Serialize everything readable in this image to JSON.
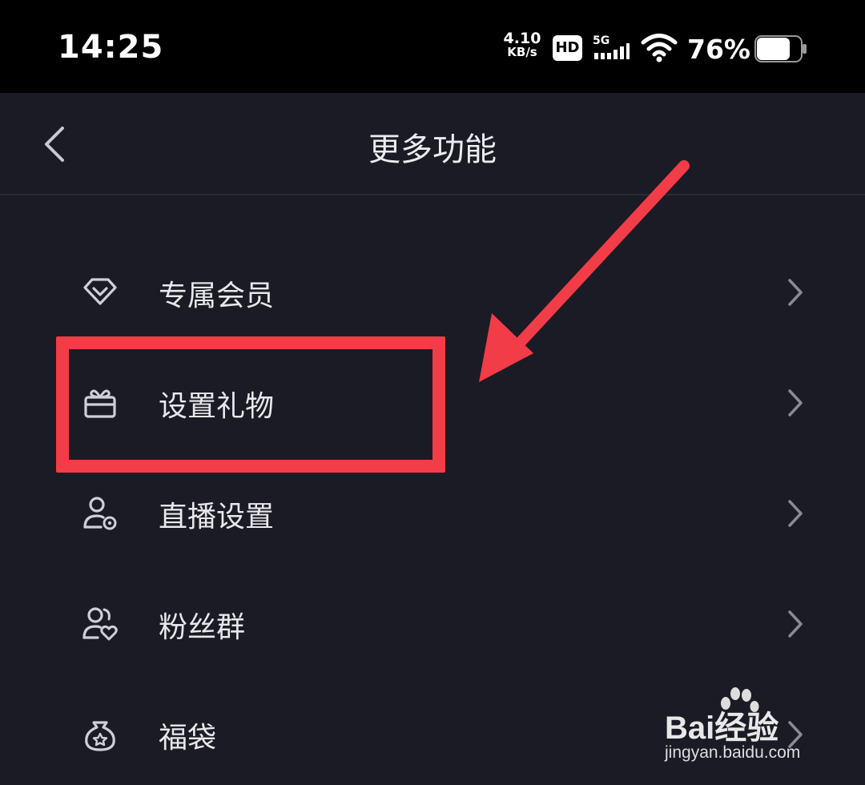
{
  "status_bar": {
    "time": "14:25",
    "net_speed_value": "4.10",
    "net_speed_unit": "KB/s",
    "hd_label": "HD",
    "network_label": "5G",
    "battery_percent": "76%",
    "battery_level": 0.76
  },
  "header": {
    "title": "更多功能"
  },
  "menu": {
    "items": [
      {
        "label": "专属会员",
        "icon": "diamond-icon"
      },
      {
        "label": "设置礼物",
        "icon": "gift-icon"
      },
      {
        "label": "直播设置",
        "icon": "user-settings-icon"
      },
      {
        "label": "粉丝群",
        "icon": "fan-group-icon"
      },
      {
        "label": "福袋",
        "icon": "lucky-bag-icon"
      }
    ]
  },
  "annotation": {
    "color": "#f23c47",
    "highlighted_item": "设置礼物"
  },
  "watermark": {
    "brand": "Bai经验",
    "url": "jingyan.baidu.com"
  }
}
